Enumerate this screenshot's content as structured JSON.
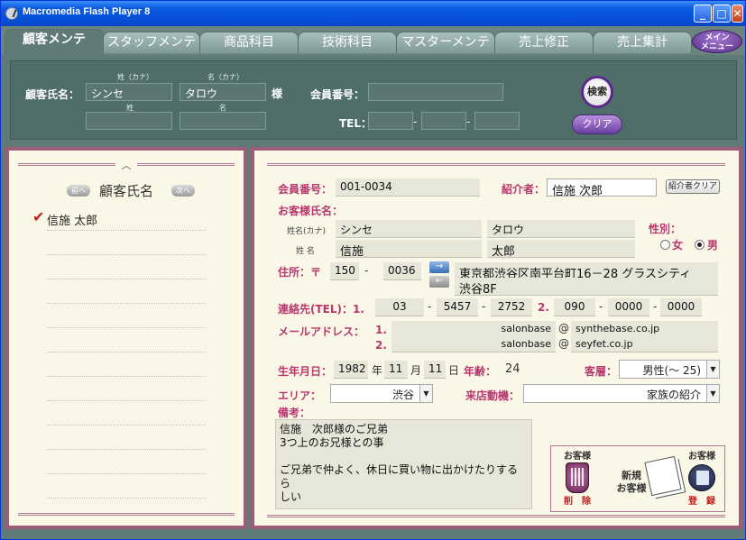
{
  "window": {
    "title": "Macromedia Flash Player 8",
    "minimize": "_",
    "maximize": "□",
    "close": "✕"
  },
  "tabs": [
    {
      "label": "顧客メンテ",
      "active": true
    },
    {
      "label": "スタッフメンテ"
    },
    {
      "label": "商品科目"
    },
    {
      "label": "技術科目"
    },
    {
      "label": "マスターメンテ"
    },
    {
      "label": "売上修正"
    },
    {
      "label": "売上集計"
    }
  ],
  "main_menu": {
    "line1": "メイン",
    "line2": "メニュー"
  },
  "search": {
    "name_label": "顧客氏名：",
    "sei_kana_label": "姓（カナ）",
    "mei_kana_label": "名（カナ）",
    "sei_label": "姓",
    "mei_label": "名",
    "sei_kana_value": "シンセ",
    "mei_kana_value": "タロウ",
    "sama": "様",
    "member_no_label": "会員番号：",
    "tel_label": "TEL：",
    "tel_dash": "-",
    "search_button": "検索",
    "clear_button": "クリア"
  },
  "list": {
    "title": "顧客氏名",
    "prev": "前へ",
    "next": "次へ",
    "handle": "︿",
    "items": [
      {
        "name": "信施 太郎",
        "selected": true
      },
      {
        "name": ""
      },
      {
        "name": ""
      },
      {
        "name": ""
      },
      {
        "name": ""
      },
      {
        "name": ""
      },
      {
        "name": ""
      },
      {
        "name": ""
      },
      {
        "name": ""
      },
      {
        "name": ""
      },
      {
        "name": ""
      },
      {
        "name": ""
      }
    ]
  },
  "detail": {
    "member_no_label": "会員番号：",
    "member_no": "001-0034",
    "referrer_label": "紹介者：",
    "referrer": "信施 次郎",
    "referrer_clear": "紹介者クリア",
    "customer_name_label": "お客様氏名：",
    "kana_label": "姓名(カナ)",
    "name_label": "姓 名",
    "sei_kana": "シンセ",
    "mei_kana": "タロウ",
    "sei": "信施",
    "mei": "太郎",
    "gender_label": "性別：",
    "gender_female": "女",
    "gender_male": "男",
    "address_label": "住所：〒",
    "zip1": "150",
    "zip2": "0036",
    "address_line1": "東京都渋谷区南平台町16－28 グラスシティ",
    "address_line2": "渋谷8F",
    "tel_label": "連絡先(TEL)：1.",
    "tel1_a": "03",
    "tel1_b": "5457",
    "tel1_c": "2752",
    "tel2_label": "2.",
    "tel2_a": "090",
    "tel2_b": "0000",
    "tel2_c": "0000",
    "dash": "-",
    "email_label": "メールアドレス：",
    "email1_no": "1.",
    "email2_no": "2.",
    "email1_user": "salonbase",
    "email1_domain": "synthebase.co.jp",
    "email2_user": "salonbase",
    "email2_domain": "seyfet.co.jp",
    "at": "@",
    "birth_label": "生年月日：",
    "birth_year": "1982",
    "year_unit": "年",
    "birth_month": "11",
    "month_unit": "月",
    "birth_day": "11",
    "day_unit": "日",
    "age_label": "年齢：",
    "age": "24",
    "segment_label": "客層：",
    "segment": "男性(～ 25)",
    "area_label": "エリア：",
    "area": "渋谷",
    "motive_label": "来店動機：",
    "motive": "家族の紹介",
    "memo_label": "備考：",
    "memo": "信施　次郎様のご兄弟\n3つ上のお兄様との事\n\nご兄弟で仲よく、休日に買い物に出かけたりするら\nしい",
    "delete_top": "お客様",
    "delete_bottom": "削　除",
    "new_line1": "新規",
    "new_line2": "お客様",
    "save_top": "お客様",
    "save_bottom": "登　録",
    "dropdown_arrow": "▼"
  }
}
